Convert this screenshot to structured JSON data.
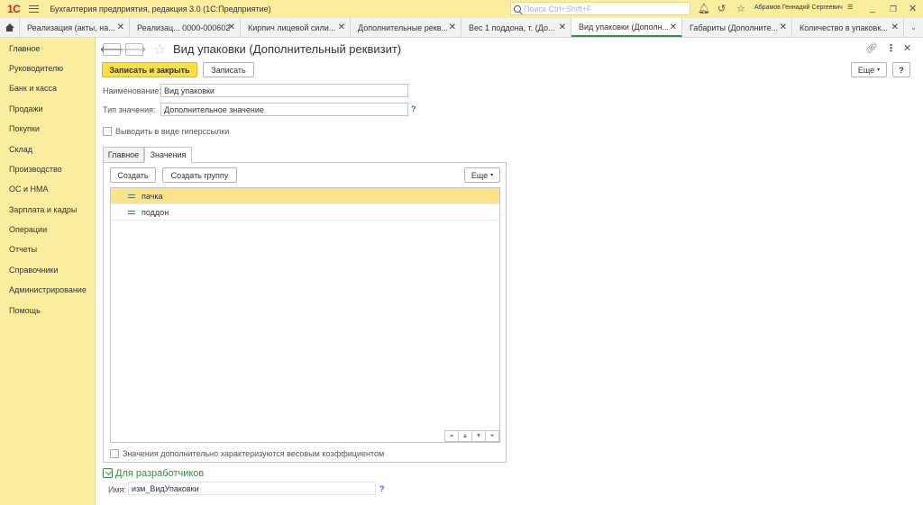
{
  "app": {
    "logo": "1С",
    "title": "Бухгалтерия предприятия, редакция 3.0  (1С:Предприятие)",
    "search_placeholder": "Поиск Ctrl+Shift+F",
    "user": "Абрамов Геннадий Сергеевич"
  },
  "tabs": [
    {
      "label": "Реализация (акты, на...",
      "active": false
    },
    {
      "label": "Реализац... 0000-000602",
      "active": false
    },
    {
      "label": "Кирпич лицевой сили...",
      "active": false
    },
    {
      "label": "Дополнительные рекв...",
      "active": false
    },
    {
      "label": "Вес 1 поддона, т. (До...",
      "active": false
    },
    {
      "label": "Вид упаковки (Дополн...",
      "active": true
    },
    {
      "label": "Габариты (Дополните...",
      "active": false
    },
    {
      "label": "Количество в упаковк...",
      "active": false
    }
  ],
  "sidebar": {
    "items": [
      {
        "label": "Главное"
      },
      {
        "label": "Руководителю"
      },
      {
        "label": "Банк и касса"
      },
      {
        "label": "Продажи"
      },
      {
        "label": "Покупки"
      },
      {
        "label": "Склад"
      },
      {
        "label": "Производство"
      },
      {
        "label": "ОС и НМА"
      },
      {
        "label": "Зарплата и кадры"
      },
      {
        "label": "Операции"
      },
      {
        "label": "Отчеты"
      },
      {
        "label": "Справочники"
      },
      {
        "label": "Администрирование"
      },
      {
        "label": "Помощь"
      }
    ]
  },
  "form": {
    "title": "Вид упаковки (Дополнительный реквизит)",
    "save_close_label": "Записать и закрыть",
    "save_label": "Записать",
    "more_label": "Еще",
    "help_label": "?",
    "name_label": "Наименование:",
    "name_value": "Вид упаковки",
    "type_label": "Тип значения:",
    "type_value": "Дополнительное значение",
    "hyperlink_label": "Выводить в виде гиперссылки",
    "subtabs": [
      {
        "label": "Главное",
        "active": false
      },
      {
        "label": "Значения",
        "active": true
      }
    ],
    "values_panel": {
      "create_label": "Создать",
      "create_group_label": "Создать группу",
      "more_label": "Еще",
      "rows": [
        {
          "label": "пачка",
          "selected": true
        },
        {
          "label": "поддон",
          "selected": false
        }
      ],
      "weight_label": "Значения дополнительно характеризуются весовым коэффициентом"
    },
    "dev_section": {
      "title": "Для разработчиков",
      "name_label": "Имя:",
      "name_value": "изм_ВидУпаковки"
    }
  },
  "colors": {
    "accent_yellow": "#fbed9e",
    "primary_button": "#fbe044",
    "selected_row": "#fbe38a",
    "dev_green": "#3a8f46",
    "help_blue": "#2c6fb6"
  }
}
